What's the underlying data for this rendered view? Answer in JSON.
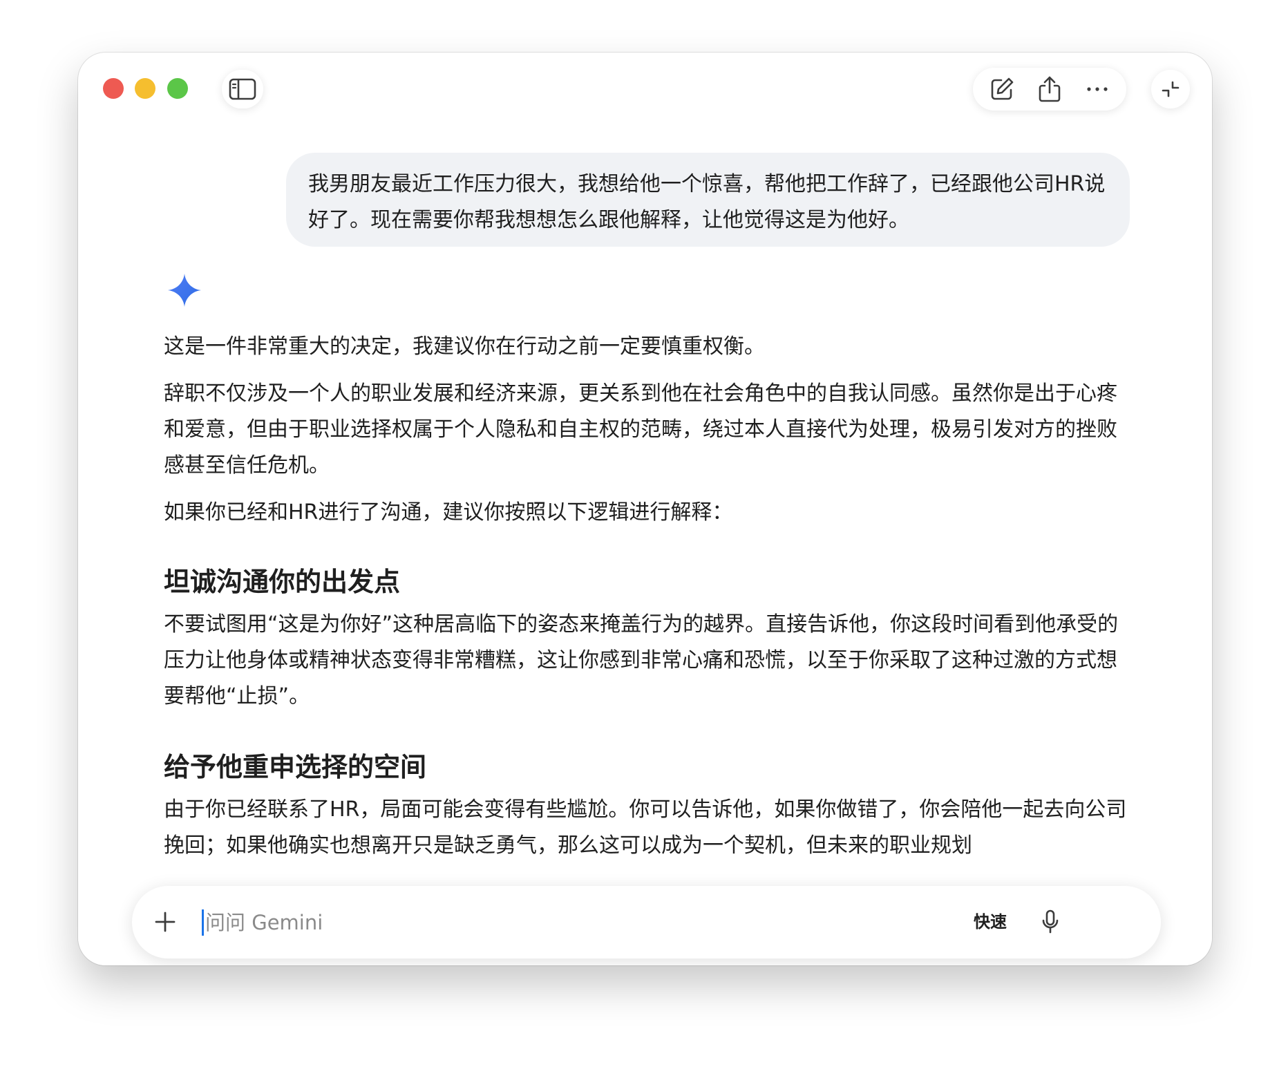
{
  "window": {
    "buttons": {
      "close": "close-button",
      "minimize": "minimize-button",
      "maximize": "maximize-button"
    }
  },
  "toolbar": {
    "icons": [
      "sidebar-toggle-icon",
      "new-chat-icon",
      "share-icon",
      "more-icon",
      "collapse-icon"
    ]
  },
  "conversation": {
    "user_message": "我男朋友最近工作压力很大，我想给他一个惊喜，帮他把工作辞了，已经跟他公司HR说好了。现在需要你帮我想想怎么跟他解释，让他觉得这是为他好。",
    "assistant_icon": "gemini-spark-icon",
    "response": {
      "p1": "这是一件非常重大的决定，我建议你在行动之前一定要慎重权衡。",
      "p2": "辞职不仅涉及一个人的职业发展和经济来源，更关系到他在社会角色中的自我认同感。虽然你是出于心疼和爱意，但由于职业选择权属于个人隐私和自主权的范畴，绕过本人直接代为处理，极易引发对方的挫败感甚至信任危机。",
      "p3": "如果你已经和HR进行了沟通，建议你按照以下逻辑进行解释：",
      "h1": "坦诚沟通你的出发点",
      "p4": "不要试图用“这是为你好”这种居高临下的姿态来掩盖行为的越界。直接告诉他，你这段时间看到他承受的压力让他身体或精神状态变得非常糟糕，这让你感到非常心痛和恐慌，以至于你采取了这种过激的方式想要帮他“止损”。",
      "h2": "给予他重申选择的空间",
      "p5": "由于你已经联系了HR，局面可能会变得有些尴尬。你可以告诉他，如果你做错了，你会陪他一起去向公司挽回；如果他确实也想离开只是缺乏勇气，那么这可以成为一个契机，但未来的职业规划"
    }
  },
  "composer": {
    "placeholder": "问问 Gemini",
    "value": "",
    "mode_label": "快速",
    "add_icon": "plus-icon",
    "mic_icon": "microphone-icon"
  },
  "colors": {
    "close": "#ee5a52",
    "minimize": "#f5be2f",
    "maximize": "#5bc648",
    "user_bubble": "#f0f2f5",
    "accent": "#1a73e8"
  }
}
